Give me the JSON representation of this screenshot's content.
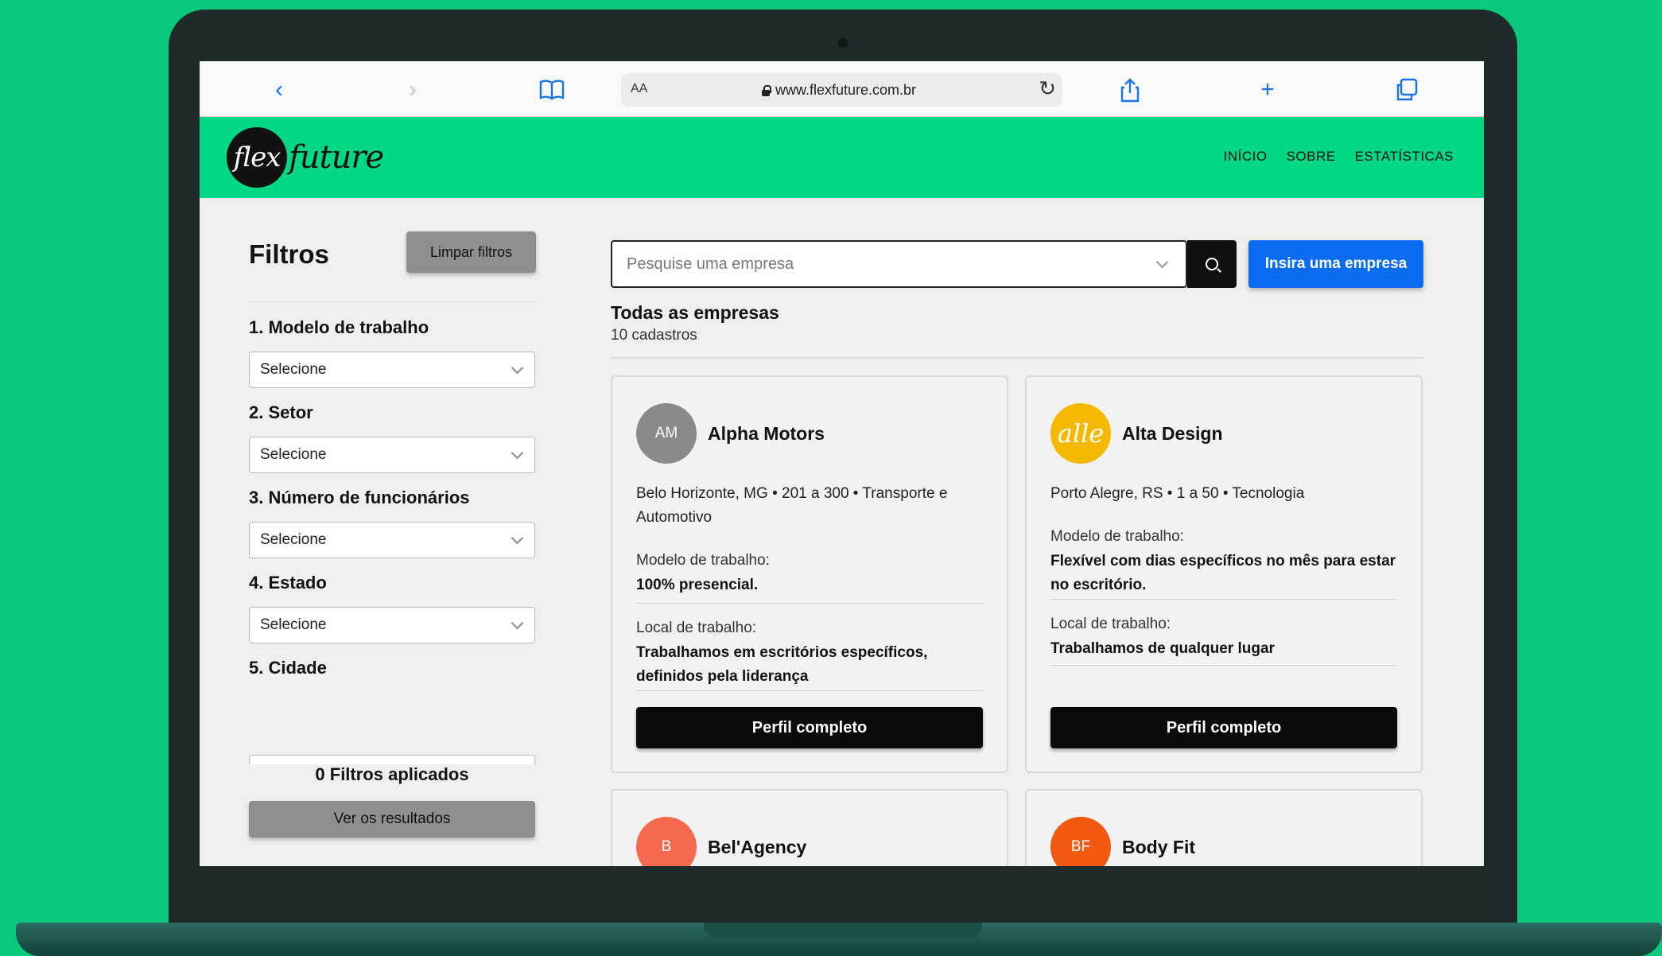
{
  "browser": {
    "aa": "AA",
    "url": "www.flexfuture.com.br"
  },
  "header": {
    "logo_mark": "flex",
    "logo_text": "future",
    "nav": [
      "INÍCIO",
      "SOBRE",
      "ESTATÍSTICAS"
    ]
  },
  "sidebar": {
    "title": "Filtros",
    "clear_label": "Limpar filtros",
    "filters": [
      {
        "label": "1. Modelo de trabalho",
        "value": "Selecione"
      },
      {
        "label": "2. Setor",
        "value": "Selecione"
      },
      {
        "label": "3. Número de funcionários",
        "value": "Selecione"
      },
      {
        "label": "4. Estado",
        "value": "Selecione"
      },
      {
        "label": "5. Cidade"
      }
    ],
    "applied": "0 Filtros aplicados",
    "results_label": "Ver os resultados"
  },
  "search": {
    "placeholder": "Pesquise uma empresa",
    "insert_label": "Insira uma empresa"
  },
  "list": {
    "title": "Todas as empresas",
    "count": "10 cadastros"
  },
  "cards": [
    {
      "initials": "AM",
      "name": "Alpha Motors",
      "info": "Belo Horizonte, MG • 201 a 300 • Transporte e Automotivo",
      "model_label": "Modelo de trabalho:",
      "model": "100% presencial.",
      "place_label": "Local de trabalho:",
      "place": "Trabalhamos em escritórios específicos, definidos pela liderança",
      "button": "Perfil completo",
      "color": "#8a8a8a"
    },
    {
      "initials": "alle",
      "name": "Alta Design",
      "info": "Porto Alegre, RS • 1 a 50 • Tecnologia",
      "model_label": "Modelo de trabalho:",
      "model": "Flexível com dias específicos no mês para estar no escritório.",
      "place_label": "Local de trabalho:",
      "place": "Trabalhamos de qualquer lugar",
      "button": "Perfil completo",
      "color": "#f5b800"
    },
    {
      "initials": "B",
      "name": "Bel'Agency",
      "color": "#f5694f"
    },
    {
      "initials": "BF",
      "name": "Body Fit",
      "color": "#f25a11"
    }
  ]
}
